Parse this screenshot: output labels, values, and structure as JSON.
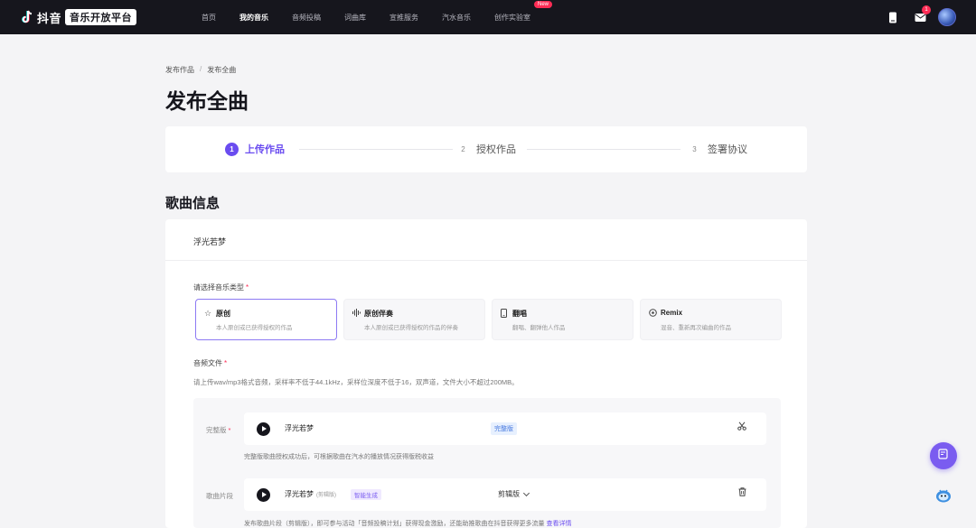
{
  "brand": {
    "name": "抖音",
    "badge": "音乐开放平台"
  },
  "nav": [
    {
      "label": "首页",
      "active": false
    },
    {
      "label": "我的音乐",
      "active": true
    },
    {
      "label": "音频投稿",
      "active": false
    },
    {
      "label": "词曲库",
      "active": false
    },
    {
      "label": "宣推服务",
      "active": false
    },
    {
      "label": "汽水音乐",
      "active": false
    },
    {
      "label": "创作实验室",
      "active": false,
      "badge": "New"
    }
  ],
  "header_right": {
    "message_count": "1"
  },
  "breadcrumb": [
    "发布作品",
    "发布全曲"
  ],
  "page_title": "发布全曲",
  "steps": [
    {
      "num": "1",
      "label": "上传作品",
      "active": true
    },
    {
      "num": "2",
      "label": "授权作品",
      "active": false
    },
    {
      "num": "3",
      "label": "签署协议",
      "active": false
    }
  ],
  "section_title": "歌曲信息",
  "song": {
    "name": "浮光若梦"
  },
  "music_type": {
    "label": "请选择音乐类型",
    "required_mark": "*",
    "options": [
      {
        "icon": "star-icon",
        "title": "原创",
        "desc": "本人原创或已获得授权的作品",
        "selected": true
      },
      {
        "icon": "waveform-icon",
        "title": "原创伴奏",
        "desc": "本人原创或已获得授权的作品的伴奏",
        "selected": false
      },
      {
        "icon": "phone-icon",
        "title": "翻唱",
        "desc": "翻唱、翻弹他人作品",
        "selected": false
      },
      {
        "icon": "disc-icon",
        "title": "Remix",
        "desc": "混音、重新再次编曲的作品",
        "selected": false
      }
    ]
  },
  "audio_file": {
    "label": "音频文件",
    "required_mark": "*",
    "hint": "请上传wav/mp3格式音频，采样率不低于44.1kHz，采样位深度不低于16，双声道，文件大小不超过200MB。",
    "full_version": {
      "label": "完整版",
      "required_mark": "*",
      "track": "浮光若梦",
      "tag": "完整版",
      "note": "完整版歌曲授权成功后，可根据歌曲在汽水的播放情况获得版税收益"
    },
    "clip": {
      "label": "歌曲片段",
      "track": "浮光若梦",
      "track_sub": "(剪辑版)",
      "tag": "智能生成",
      "version": "剪辑版",
      "note": "发布歌曲片段（剪辑版），即可参与活动「音频投稿计划」获得现金激励，还能助推歌曲在抖音获得更多流量",
      "note_link": "查看详情"
    }
  },
  "colors": {
    "accent": "#6a4cf0",
    "topbar": "#16161d",
    "badge_red": "#fe2c55"
  }
}
